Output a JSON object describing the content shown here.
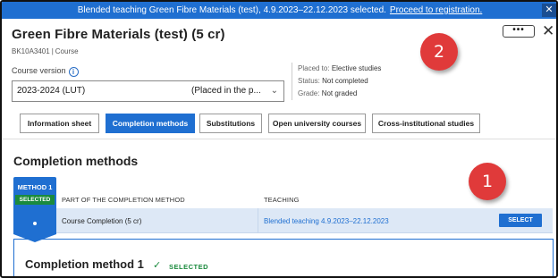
{
  "notification": {
    "message": "Blended teaching Green Fibre Materials (test), 4.9.2023–22.12.2023 selected.",
    "link": "Proceed to registration.",
    "close_glyph": "✕"
  },
  "course": {
    "title": "Green Fibre Materials (test) (5 cr)",
    "code": "BK10A3401",
    "type": "Course"
  },
  "header_actions": {
    "more": "•••",
    "close": "✕"
  },
  "course_version": {
    "label": "Course version",
    "value": "2023-2024 (LUT)",
    "placement": "(Placed in the p...",
    "chevron": "⌄"
  },
  "meta": [
    {
      "key": "Placed to:",
      "value": "Elective studies"
    },
    {
      "key": "Status:",
      "value": "Not completed"
    },
    {
      "key": "Grade:",
      "value": "Not graded"
    }
  ],
  "tabs": [
    {
      "label": "Information sheet",
      "active": false
    },
    {
      "label": "Completion methods",
      "active": true
    },
    {
      "label": "Substitutions",
      "active": false
    },
    {
      "label": "Open university courses",
      "active": false
    },
    {
      "label": "Cross-institutional studies",
      "active": false
    }
  ],
  "section_title": "Completion methods",
  "method": {
    "label": "METHOD 1",
    "status": "SELECTED"
  },
  "table": {
    "headers": [
      "PART OF THE COMPLETION METHOD",
      "TEACHING"
    ],
    "row": {
      "part": "Course Completion (5 cr)",
      "teaching": "Blended teaching 4.9.2023–22.12.2023",
      "action": "SELECT"
    }
  },
  "card": {
    "title": "Completion method 1",
    "check": "✓",
    "status": "SELECTED"
  },
  "annotations": [
    "1",
    "2"
  ],
  "colors": {
    "primary": "#1f6fd1",
    "success": "#1a8a3d",
    "annotation": "#e03a3a"
  }
}
